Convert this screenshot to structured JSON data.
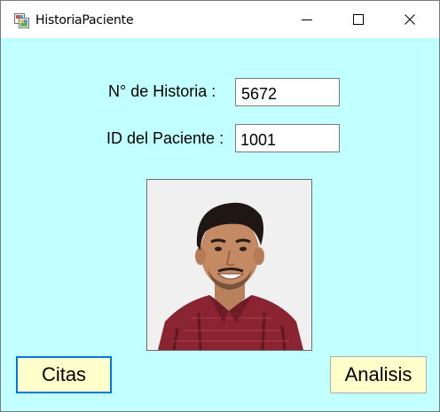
{
  "window": {
    "title": "HistoriaPaciente",
    "background": "#c2ffff"
  },
  "titlebar": {
    "icon": "app-window-icon",
    "minimize_icon": "minimize-icon",
    "maximize_icon": "maximize-icon",
    "close_icon": "close-icon"
  },
  "form": {
    "historia_label": "N° de Historia :",
    "historia_value": "5672",
    "id_label": "ID del Paciente :",
    "id_value": "1001"
  },
  "photo": {
    "description": "patient-photo"
  },
  "buttons": {
    "citas_label": "Citas",
    "analisis_label": "Analisis",
    "color": "#ffffcc",
    "focus_color": "#0078d7"
  }
}
